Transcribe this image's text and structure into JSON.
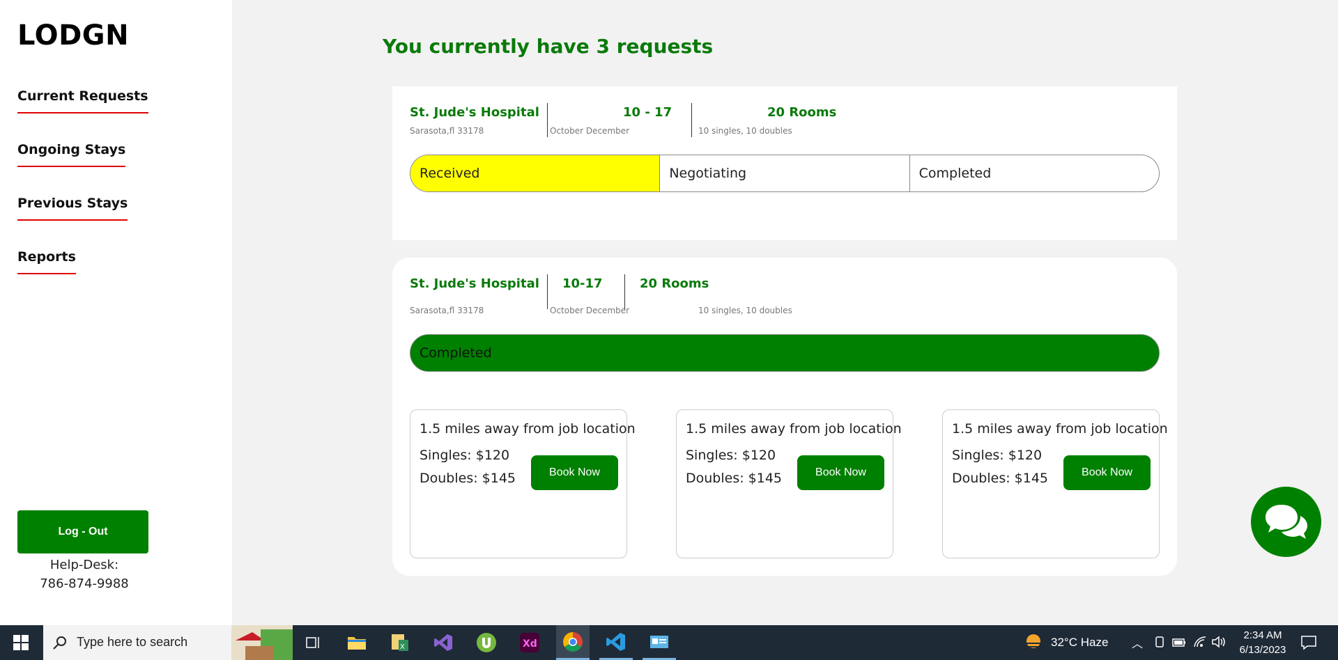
{
  "sidebar": {
    "logo": "LODGN",
    "nav": [
      {
        "label": "Current Requests"
      },
      {
        "label": "Ongoing Stays"
      },
      {
        "label": "Previous Stays"
      },
      {
        "label": "Reports"
      }
    ],
    "logout_label": "Log - Out",
    "helpdesk_label": "Help-Desk:",
    "helpdesk_phone": "786-874-9988"
  },
  "main": {
    "title": "You currently have 3 requests",
    "requests": [
      {
        "hospital": "St. Jude's Hospital",
        "address": "Sarasota,fl 33178",
        "dates": "10 - 17",
        "months": "October December",
        "rooms": "20 Rooms",
        "room_detail": "10 singles, 10 doubles",
        "stages": [
          "Received",
          "Negotiating",
          "Completed"
        ],
        "active_stage": "Received"
      },
      {
        "hospital": "St. Jude's Hospital",
        "address": "Sarasota,fl 33178",
        "dates": "10-17",
        "months": "October December",
        "rooms": "20 Rooms",
        "room_detail": "10 singles, 10 doubles",
        "status": "Completed",
        "hotels": [
          {
            "distance": "1.5 miles away from job location",
            "singles": "Singles: $120",
            "doubles": "Doubles: $145",
            "button": "Book Now"
          },
          {
            "distance": "1.5 miles away from job location",
            "singles": "Singles: $120",
            "doubles": "Doubles: $145",
            "button": "Book Now"
          },
          {
            "distance": "1.5 miles away from job location",
            "singles": "Singles: $120",
            "doubles": "Doubles: $145",
            "button": "Book Now"
          }
        ]
      }
    ]
  },
  "colors": {
    "brand_green": "#008000",
    "heading_green": "#0a7a0a",
    "received_yellow": "#ffff00",
    "nav_underline": "#e00000"
  },
  "chat_icon": "chat-bubbles-icon",
  "taskbar": {
    "search_placeholder": "Type here to search",
    "weather": "32°C  Haze",
    "time": "2:34 AM",
    "date": "6/13/2023"
  }
}
